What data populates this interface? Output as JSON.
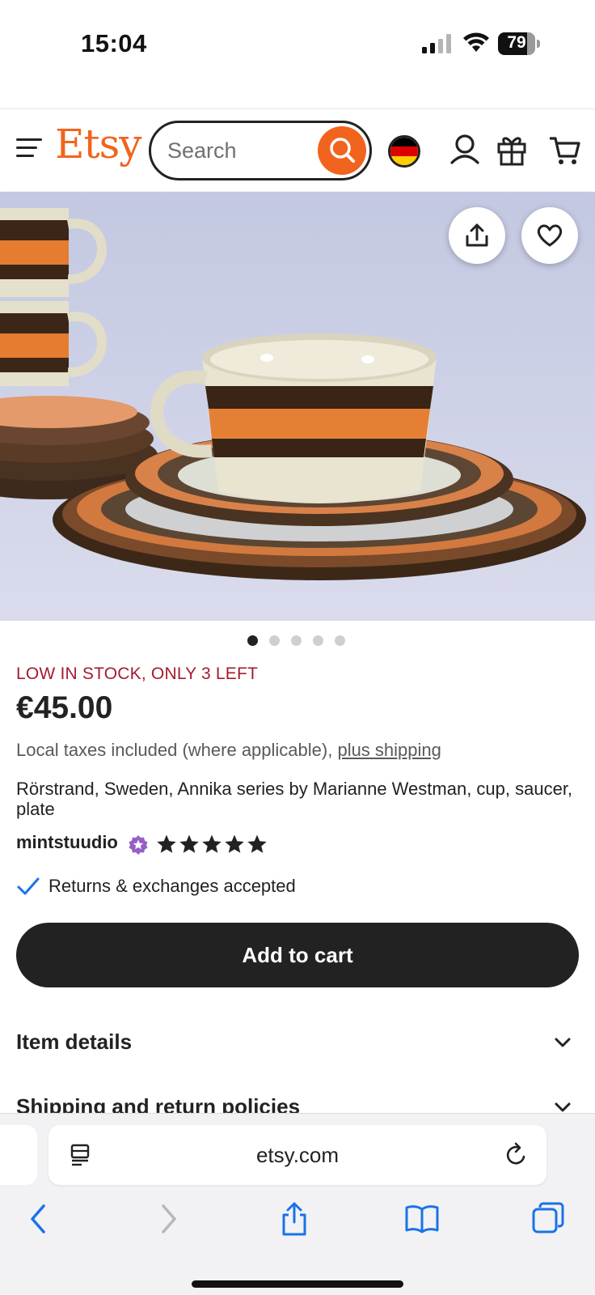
{
  "status_bar": {
    "time": "15:04",
    "battery": "79",
    "battery_level": 0.79
  },
  "header": {
    "logo": "Etsy",
    "search": {
      "placeholder": "Search",
      "value": ""
    },
    "flag_colors": [
      "#000000",
      "#dd0000",
      "#ffce00"
    ],
    "icons": [
      "menu-icon",
      "search-icon",
      "flag-icon",
      "account-icon",
      "gift-icon",
      "cart-icon"
    ]
  },
  "hero": {
    "icons": [
      "share-icon",
      "heart-icon"
    ],
    "carousel": {
      "count": 5,
      "active": 0
    }
  },
  "product": {
    "stock_notice": "LOW IN STOCK, ONLY 3 LEFT",
    "price": "€45.00",
    "taxes_text": "Local taxes included (where applicable), ",
    "shipping_link": "plus shipping",
    "title": "Rörstrand, Sweden, Annika series by Marianne Westman, cup, saucer, plate",
    "shop_name": "mintstuudio",
    "rating": 5,
    "returns": "Returns & exchanges accepted",
    "add_to_cart": "Add to cart"
  },
  "sections": [
    {
      "label": "Item details"
    },
    {
      "label": "Shipping and return policies"
    }
  ],
  "browser": {
    "url": "etsy.com",
    "icons": [
      "reader-icon",
      "reload-icon",
      "back-icon",
      "forward-icon",
      "share-icon",
      "bookmarks-icon",
      "tabs-icon"
    ]
  },
  "colors": {
    "brand": "#f1641e",
    "stock_red": "#a61a2e",
    "text": "#222222",
    "ios_blue": "#1a73e8",
    "star_seller": "#9560c6"
  }
}
